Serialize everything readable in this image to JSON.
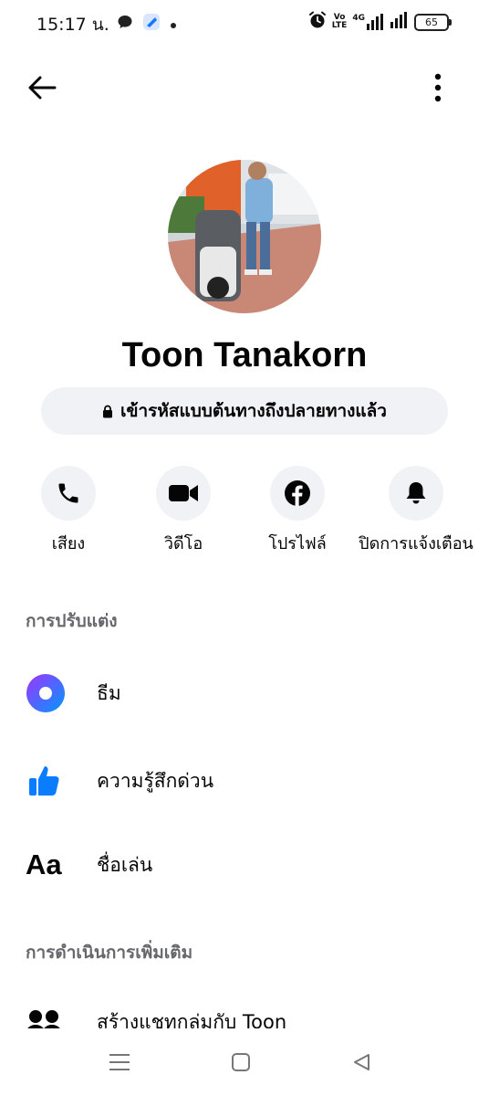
{
  "status_bar": {
    "time": "15:17 น.",
    "network": "4G",
    "battery": "65",
    "volte_top": "Vo",
    "volte_bottom": "LTE"
  },
  "profile": {
    "name": "Toon Tanakorn",
    "encryption_label": "เข้ารหัสแบบต้นทางถึงปลายทางแล้ว"
  },
  "actions": [
    {
      "label": "เสียง",
      "icon": "phone-icon"
    },
    {
      "label": "วิดีโอ",
      "icon": "video-camera-icon"
    },
    {
      "label": "โปรไฟล์",
      "icon": "facebook-icon"
    },
    {
      "label": "ปิดการแจ้งเตือน",
      "icon": "bell-icon"
    }
  ],
  "customization": {
    "title": "การปรับแต่ง",
    "items": [
      {
        "label": "ธีม",
        "icon": "theme-icon"
      },
      {
        "label": "ความรู้สึกด่วน",
        "icon": "thumbs-up-icon"
      },
      {
        "label": "ชื่อเล่น",
        "icon_text": "Aa"
      }
    ]
  },
  "more_actions": {
    "title": "การดำเนินการเพิ่มเติม",
    "items": [
      {
        "label": "สร้างแชทกลุ่มกับ Toon",
        "icon": "group-icon"
      }
    ]
  },
  "colors": {
    "accent": "#0a7cff",
    "pill_bg": "#f0f2f5",
    "section_title": "#65676b",
    "theme_gradient_start": "#a033ff",
    "theme_gradient_end": "#0099ff"
  }
}
